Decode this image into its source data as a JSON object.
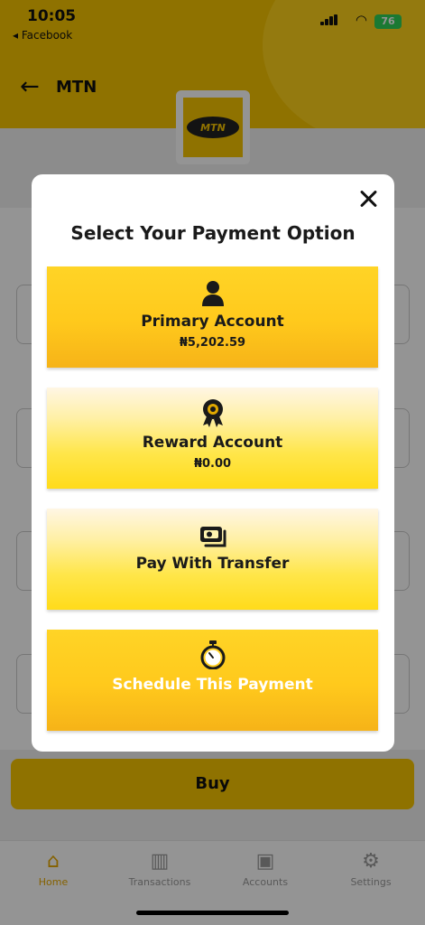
{
  "status_bar": {
    "time": "10:05",
    "back_app": "◂ Facebook",
    "battery": "76"
  },
  "nav": {
    "title": "MTN"
  },
  "logo": {
    "text": "MTN"
  },
  "modal": {
    "title": "Select Your Payment Option",
    "options": [
      {
        "label": "Primary Account",
        "amount": "₦5,202.59",
        "icon": "user-icon"
      },
      {
        "label": "Reward Account",
        "amount": "₦0.00",
        "icon": "award-badge-icon"
      },
      {
        "label": "Pay With Transfer",
        "icon": "cash-transfer-icon"
      },
      {
        "label": "Schedule This Payment",
        "icon": "stopwatch-icon"
      }
    ]
  },
  "buy_button": "Buy",
  "tabs": [
    {
      "label": "Home",
      "icon": "home-icon",
      "active": true
    },
    {
      "label": "Transactions",
      "icon": "bar-chart-icon"
    },
    {
      "label": "Accounts",
      "icon": "wallet-icon"
    },
    {
      "label": "Settings",
      "icon": "gear-icon"
    }
  ],
  "colors": {
    "brand_yellow": "#f7c400",
    "option_gold": "#ffd426",
    "text_dark": "#1a1a1a"
  }
}
